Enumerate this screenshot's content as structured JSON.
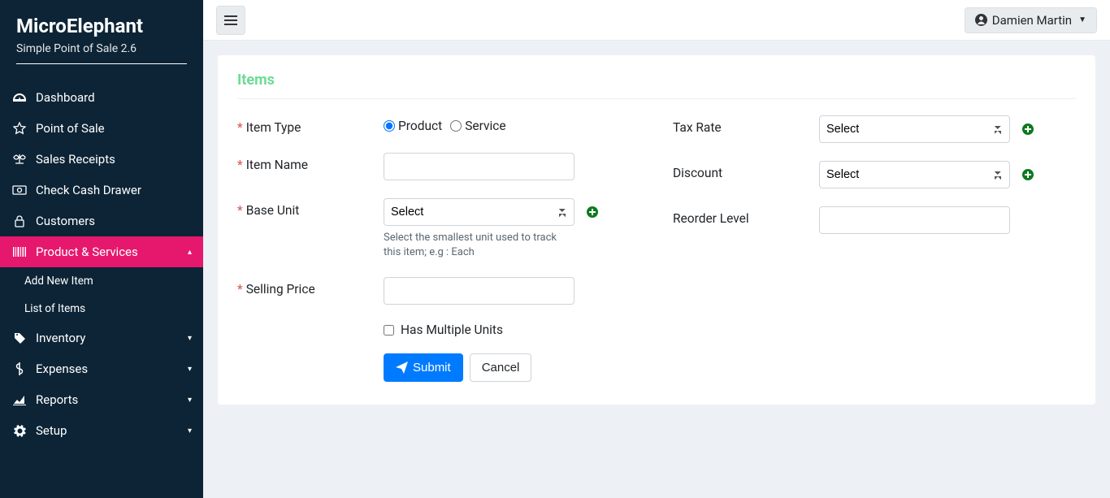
{
  "brand": {
    "name": "MicroElephant",
    "tagline": "Simple Point of Sale 2.6"
  },
  "user": {
    "name": "Damien Martin"
  },
  "sidebar": {
    "items": [
      {
        "label": "Dashboard",
        "icon": "dashboard"
      },
      {
        "label": "Point of Sale",
        "icon": "star"
      },
      {
        "label": "Sales Receipts",
        "icon": "scale"
      },
      {
        "label": "Check Cash Drawer",
        "icon": "cash"
      },
      {
        "label": "Customers",
        "icon": "lock"
      },
      {
        "label": "Product & Services",
        "icon": "barcode",
        "active": true,
        "expanded": true,
        "children": [
          {
            "label": "Add New Item"
          },
          {
            "label": "List of Items"
          }
        ]
      },
      {
        "label": "Inventory",
        "icon": "tag",
        "expandable": true
      },
      {
        "label": "Expenses",
        "icon": "dollar",
        "expandable": true
      },
      {
        "label": "Reports",
        "icon": "chart",
        "expandable": true
      },
      {
        "label": "Setup",
        "icon": "gear",
        "expandable": true
      }
    ]
  },
  "page": {
    "title": "Items"
  },
  "form": {
    "item_type": {
      "label": "Item Type",
      "required": true,
      "options": [
        "Product",
        "Service"
      ],
      "value": "Product"
    },
    "item_name": {
      "label": "Item Name",
      "required": true,
      "value": ""
    },
    "base_unit": {
      "label": "Base Unit",
      "required": true,
      "placeholder": "Select",
      "helper": "Select the smallest unit used to track this item; e.g : Each"
    },
    "selling_price": {
      "label": "Selling Price",
      "required": true,
      "value": ""
    },
    "multi_unit": {
      "label": "Has Multiple Units",
      "checked": false
    },
    "tax_rate": {
      "label": "Tax Rate",
      "placeholder": "Select"
    },
    "discount": {
      "label": "Discount",
      "placeholder": "Select"
    },
    "reorder_level": {
      "label": "Reorder Level",
      "value": ""
    },
    "submit": "Submit",
    "cancel": "Cancel"
  }
}
